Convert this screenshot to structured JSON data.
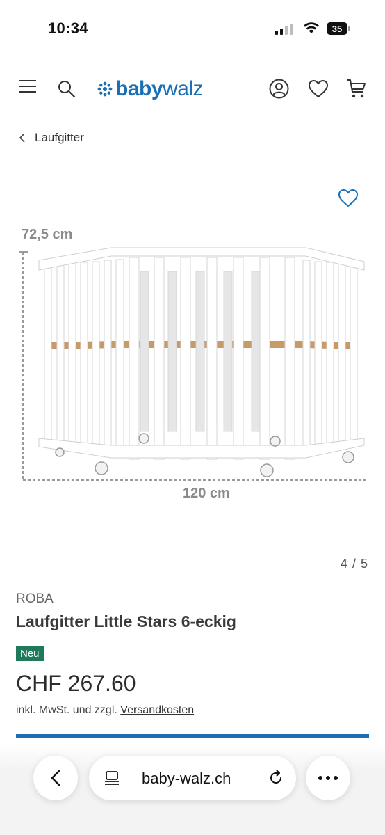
{
  "status_bar": {
    "time": "10:34",
    "battery": "35"
  },
  "header": {
    "logo_part1": "baby",
    "logo_part2": "walz",
    "icons": [
      "menu-icon",
      "search-icon",
      "account-icon",
      "heart-icon",
      "cart-icon"
    ]
  },
  "breadcrumb": {
    "label": "Laufgitter"
  },
  "gallery": {
    "dimension_height": "72,5 cm",
    "dimension_width": "120 cm",
    "pager": "4 / 5"
  },
  "product": {
    "brand": "ROBA",
    "title": "Laufgitter Little Stars 6-eckig",
    "badge": "Neu",
    "price": "CHF 267.60",
    "tax_prefix": "inkl. MwSt. und zzgl.",
    "shipping_link": "Versandkosten"
  },
  "browser": {
    "url": "baby-walz.ch"
  },
  "colors": {
    "brand_blue": "#1b6fb5",
    "badge_green": "#1f7a5c"
  }
}
